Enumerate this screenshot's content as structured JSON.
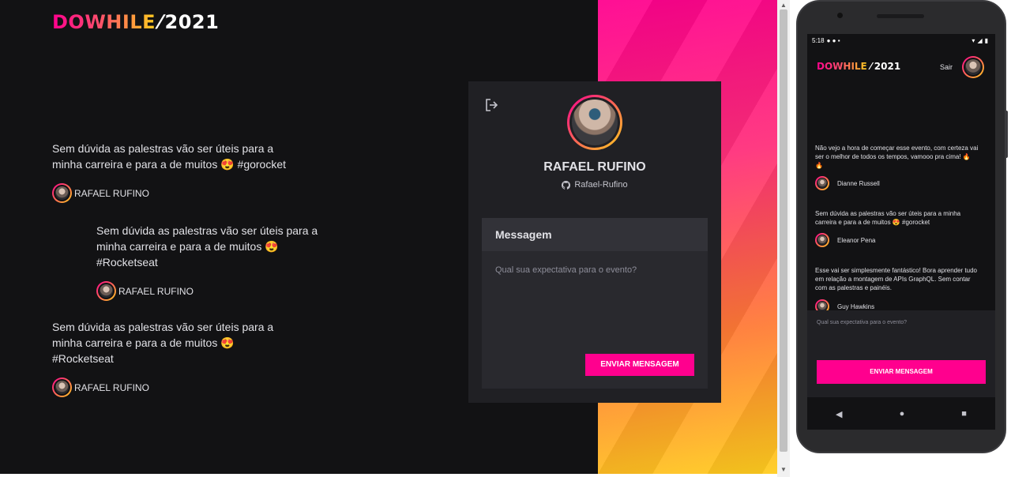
{
  "app": {
    "logo": {
      "brand": "DOWHILE",
      "slash": "⁄",
      "year": "2021"
    }
  },
  "web": {
    "messages": [
      {
        "text": "Sem dúvida as palestras vão ser úteis para a\nminha carreira e para a de muitos 😍  #gorocket",
        "user": "RAFAEL RUFINO"
      },
      {
        "text": "Sem dúvida as palestras vão ser úteis para a\nminha carreira e para a de muitos 😍\n#Rocketseat",
        "user": "RAFAEL RUFINO"
      },
      {
        "text": "Sem dúvida as palestras vão ser úteis para a\nminha carreira e para a de muitos 😍\n#Rocketseat",
        "user": "RAFAEL RUFINO"
      }
    ],
    "card": {
      "name": "RAFAEL RUFINO",
      "github": "Rafael-Rufino",
      "form_label": "Messagem",
      "placeholder": "Qual sua expectativa para o evento?",
      "send_label": "ENVIAR MENSAGEM"
    }
  },
  "mobile": {
    "status": {
      "time": "5:18"
    },
    "signout": "Sair",
    "messages": [
      {
        "text": "Não vejo a hora de começar esse evento, com certeza vai\nser o melhor de todos os tempos, vamooo pra cima! 🔥\n🔥",
        "user": "Dianne Russell"
      },
      {
        "text": "Sem dúvida as palestras vão ser úteis para a minha\ncarreira e para a de muitos 😍 #gorocket",
        "user": "Eleanor Pena"
      },
      {
        "text": "Esse vai ser simplesmente fantástico! Bora aprender tudo\nem relação a montagem de APIs GraphQL. Sem contar\ncom as palestras e painéis.",
        "user": "Guy Hawkins"
      }
    ],
    "placeholder": "Qual sua expectativa para o evento?",
    "send_label": "ENVIAR MENSAGEM",
    "nav": {
      "back": "◀",
      "home": "●",
      "recent": "■"
    }
  },
  "icons": [
    "sign-out-icon",
    "github-icon",
    "wifi-icon",
    "signal-icon",
    "battery-icon"
  ],
  "colors": {
    "background": "#121214",
    "accent": "#ff008e",
    "gradient_end": "#ffcd1e",
    "card": "#202024"
  }
}
